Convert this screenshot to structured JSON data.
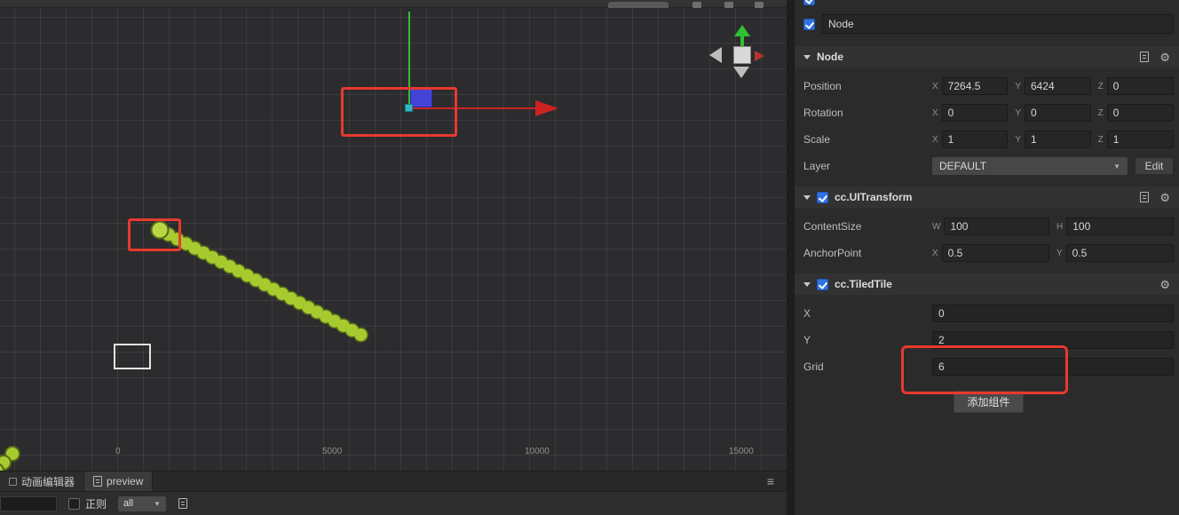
{
  "icons": {
    "gear": "⚙",
    "menu": "≡",
    "caret_down": "▼"
  },
  "colors": {
    "annotation_red": "#e8392f",
    "checkbox_blue": "#2f72e4",
    "axis_green": "#35c12f",
    "axis_red": "#cc2222",
    "node_blue": "#4343d6",
    "tile_green": "#a7cb2e"
  },
  "scene": {
    "axis_labels": [
      "0",
      "5000",
      "10000",
      "15000"
    ]
  },
  "tabs": {
    "animation": "动画编辑器",
    "preview": "preview"
  },
  "statusbar": {
    "search_value": "",
    "regex_label": "正则",
    "filter_value": "all"
  },
  "inspector": {
    "node_name": "Node",
    "axis_letters": {
      "x": "X",
      "y": "Y",
      "z": "Z",
      "w": "W",
      "h": "H"
    },
    "node_section": {
      "title": "Node",
      "rows": {
        "position": {
          "label": "Position",
          "x": "7264.5",
          "y": "6424",
          "z": "0"
        },
        "rotation": {
          "label": "Rotation",
          "x": "0",
          "y": "0",
          "z": "0"
        },
        "scale": {
          "label": "Scale",
          "x": "1",
          "y": "1",
          "z": "1"
        },
        "layer": {
          "label": "Layer",
          "value": "DEFAULT",
          "edit": "Edit"
        }
      }
    },
    "uitransform_section": {
      "title": "cc.UITransform",
      "rows": {
        "content_size": {
          "label": "ContentSize",
          "w": "100",
          "h": "100"
        },
        "anchor_point": {
          "label": "AnchorPoint",
          "x": "0.5",
          "y": "0.5"
        }
      }
    },
    "tiledtile_section": {
      "title": "cc.TiledTile",
      "rows": {
        "x": {
          "label": "X",
          "value": "0"
        },
        "y": {
          "label": "Y",
          "value": "2"
        },
        "grid": {
          "label": "Grid",
          "value": "6"
        }
      }
    },
    "add_component_label": "添加组件"
  }
}
